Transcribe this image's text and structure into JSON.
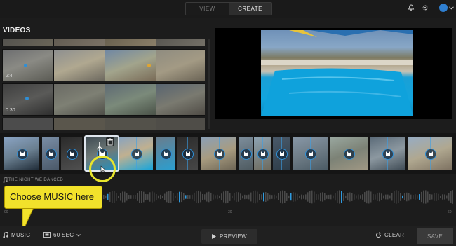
{
  "header": {
    "tabs": [
      {
        "label": "VIEW",
        "active": false
      },
      {
        "label": "CREATE",
        "active": true
      }
    ],
    "icons": [
      "bell-icon",
      "gear-icon",
      "account-icon",
      "chevron-down-icon"
    ]
  },
  "videos": {
    "title": "VIDEOS",
    "thumbnails": [
      {
        "duration": ""
      },
      {
        "duration": ""
      },
      {
        "duration": ""
      },
      {
        "duration": ""
      },
      {
        "duration": "2:4"
      },
      {
        "duration": ""
      },
      {
        "duration": ""
      },
      {
        "duration": ""
      },
      {
        "duration": "0:30"
      },
      {
        "duration": ""
      },
      {
        "duration": ""
      },
      {
        "duration": ""
      }
    ]
  },
  "timeline": {
    "music_track_label": "THE NIGHT WE DANCED",
    "time_ticks": [
      "00",
      "30",
      "60"
    ]
  },
  "callout": {
    "text": "Choose MUSIC here"
  },
  "footer": {
    "music_label": "MUSIC",
    "duration_label": "60 SEC",
    "preview_label": "PREVIEW",
    "clear_label": "CLEAR",
    "save_label": "SAVE"
  },
  "colors": {
    "accent": "#2f8fd6",
    "callout": "#f2e22b",
    "highlight": "#e8e52c"
  }
}
